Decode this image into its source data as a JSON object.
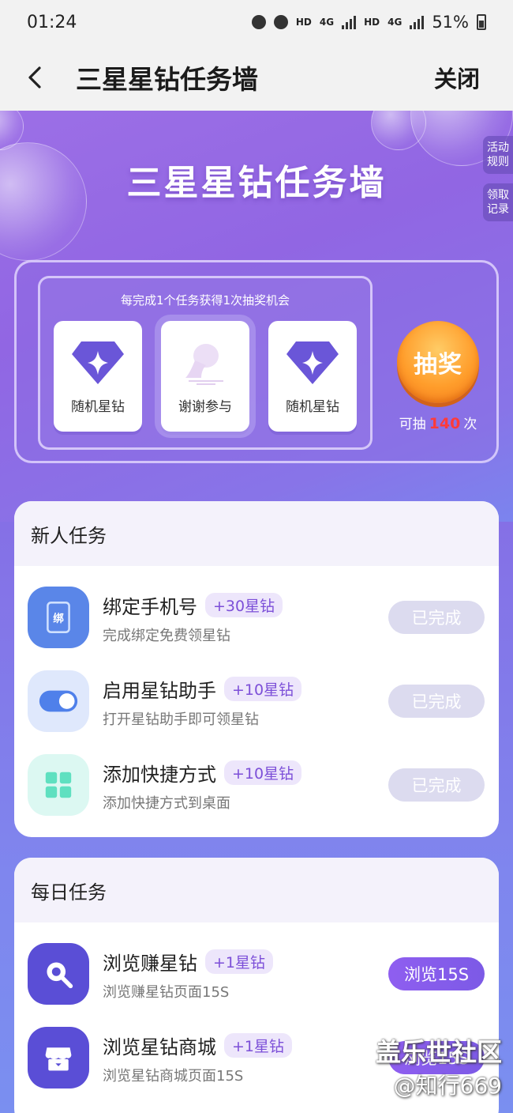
{
  "status_bar": {
    "time": "01:24",
    "net1": "HD",
    "net1_type": "4G",
    "net2": "HD",
    "net2_type": "4G",
    "battery": "51%"
  },
  "header": {
    "title": "三星星钻任务墙",
    "close_label": "关闭"
  },
  "hero": {
    "title": "三星星钻任务墙",
    "side_tabs": [
      {
        "line1": "活动",
        "line2": "规则"
      },
      {
        "line1": "领取",
        "line2": "记录"
      }
    ],
    "lottery_hint": "每完成1个任务获得1次抽奖机会",
    "prizes": [
      {
        "label": "随机星钻",
        "icon": "diamond-icon"
      },
      {
        "label": "谢谢参与",
        "icon": "thanks-icon"
      },
      {
        "label": "随机星钻",
        "icon": "diamond-icon"
      }
    ],
    "draw_button": "抽奖",
    "draw_count_prefix": "可抽",
    "draw_count": "140",
    "draw_count_suffix": "次"
  },
  "new_tasks": {
    "title": "新人任务",
    "items": [
      {
        "title": "绑定手机号",
        "badge": "+30星钻",
        "desc": "完成绑定免费领星钻",
        "button": "已完成",
        "icon": "phone-bind-icon",
        "icon_text": "绑"
      },
      {
        "title": "启用星钻助手",
        "badge": "+10星钻",
        "desc": "打开星钻助手即可领星钻",
        "button": "已完成",
        "icon": "toggle-icon"
      },
      {
        "title": "添加快捷方式",
        "badge": "+10星钻",
        "desc": "添加快捷方式到桌面",
        "button": "已完成",
        "icon": "grid-icon"
      }
    ]
  },
  "daily_tasks": {
    "title": "每日任务",
    "items": [
      {
        "title": "浏览赚星钻",
        "badge": "+1星钻",
        "desc": "浏览赚星钻页面15S",
        "button": "浏览15S",
        "icon": "search-browse-icon"
      },
      {
        "title": "浏览星钻商城",
        "badge": "+1星钻",
        "desc": "浏览星钻商城页面15S",
        "button": "浏览15S",
        "icon": "store-icon"
      }
    ]
  },
  "watermark": {
    "line1": "盖乐世社区",
    "line2": "@知行669"
  },
  "colors": {
    "accent": "#8f5ef0",
    "draw_button": "#ff9d2b",
    "draw_count": "#ff3b3b",
    "done_button": "#dcdbef"
  }
}
